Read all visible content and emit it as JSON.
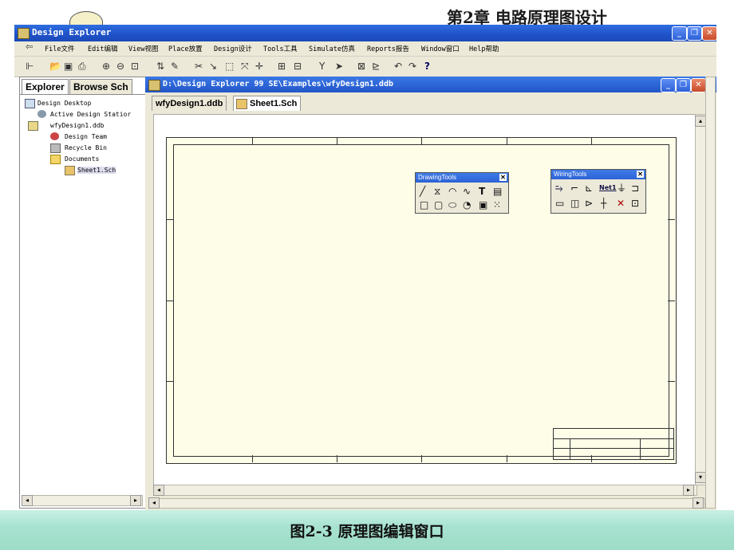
{
  "slide": {
    "title": "第2章  电路原理图设计",
    "caption": "图2-3  原理图编辑窗口"
  },
  "app": {
    "title": "Design Explorer"
  },
  "window_controls": {
    "minimize": "_",
    "maximize": "❐",
    "close": "✕"
  },
  "menu": [
    "File文件",
    "Edit编辑",
    "View视图",
    "Place放置",
    "Design设计",
    "Tools工具",
    "Simulate仿真",
    "Reports报告",
    "Window窗口",
    "Help帮助"
  ],
  "panel": {
    "tabs": [
      "Explorer",
      "Browse Sch"
    ],
    "tree": [
      {
        "label": "Design Desktop",
        "icon": "desktop-icon"
      },
      {
        "label": "Active Design Statior",
        "icon": "station-icon"
      },
      {
        "label": "wfyDesign1.ddb",
        "icon": "database-icon"
      },
      {
        "label": "Design Team",
        "icon": "team-icon"
      },
      {
        "label": "Recycle Bin",
        "icon": "recycle-bin-icon"
      },
      {
        "label": "Documents",
        "icon": "folder-icon"
      },
      {
        "label": "Sheet1.Sch",
        "icon": "schematic-sheet-icon"
      }
    ]
  },
  "document": {
    "title": "D:\\Design Explorer 99 SE\\Examples\\wfyDesign1.ddb",
    "tabs": [
      "wfyDesign1.ddb",
      "Sheet1.Sch"
    ],
    "active_tab": "Sheet1.Sch"
  },
  "palettes": {
    "drawing": {
      "title": "DrawingTools"
    },
    "wiring": {
      "title": "WiringTools",
      "netlabel": "Net1"
    }
  },
  "colors": {
    "titlebar": "#2355cc",
    "sheet": "#fdfde8",
    "caption_band": "#a8e3d1"
  }
}
